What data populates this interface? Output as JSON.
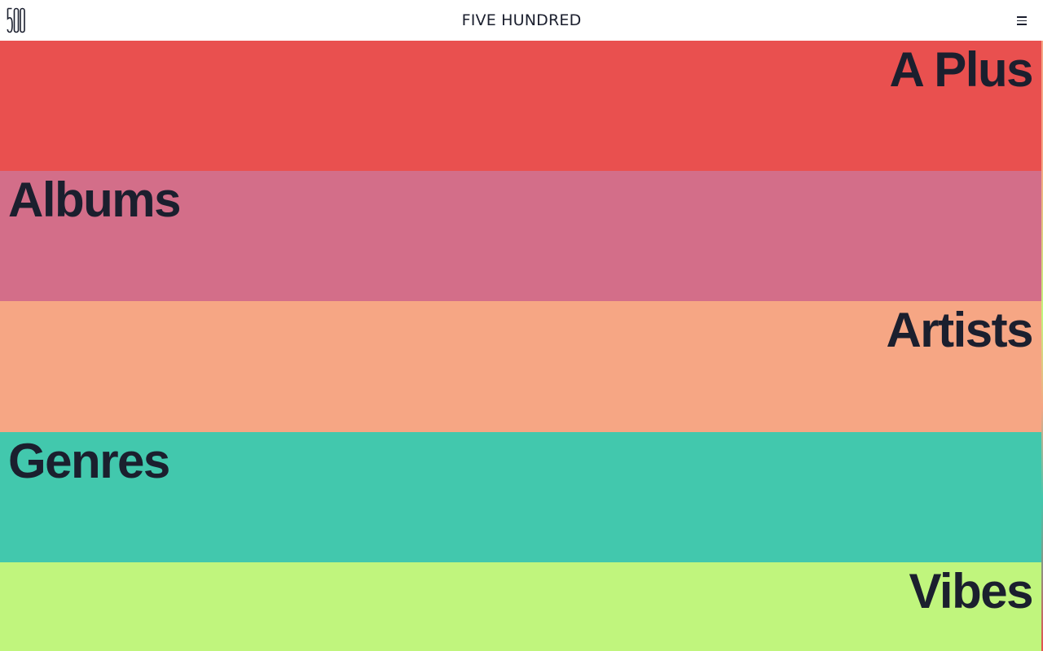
{
  "header": {
    "logo_alt": "500",
    "title": "FIVE HUNDRED",
    "menu_icon": "hamburger-menu-icon"
  },
  "sections": [
    {
      "label": "A Plus",
      "color": "#e9504f",
      "align": "right"
    },
    {
      "label": "Albums",
      "color": "#d36e89",
      "align": "left"
    },
    {
      "label": "Artists",
      "color": "#f6a684",
      "align": "right"
    },
    {
      "label": "Genres",
      "color": "#42c8ad",
      "align": "left"
    },
    {
      "label": "Vibes",
      "color": "#c0f57d",
      "align": "right"
    }
  ],
  "text_color": "#1b1f2e"
}
